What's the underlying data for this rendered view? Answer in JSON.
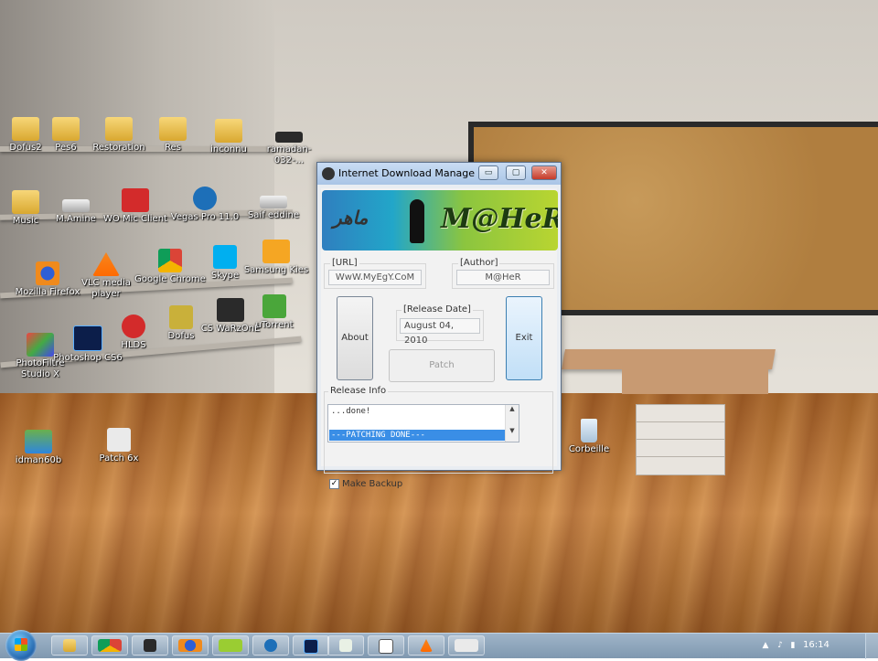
{
  "desktop": {
    "icons": [
      {
        "label": "Dofus2",
        "icon": "folder-icon"
      },
      {
        "label": "Pes6",
        "icon": "folder-icon"
      },
      {
        "label": "Restoration",
        "icon": "folder-icon"
      },
      {
        "label": "Res",
        "icon": "folder-icon"
      },
      {
        "label": "inconnu",
        "icon": "folder-icon"
      },
      {
        "label": "ramadan-032-...",
        "icon": "file-icon"
      },
      {
        "label": "Music",
        "icon": "folder-icon"
      },
      {
        "label": "M.Amine",
        "icon": "drive-icon"
      },
      {
        "label": "WO Mic Client",
        "icon": "mic-icon"
      },
      {
        "label": "Vegas Pro 11.0",
        "icon": "vegas-icon"
      },
      {
        "label": "Saif eddine",
        "icon": "drive-icon"
      },
      {
        "label": "Mozilla Firefox",
        "icon": "firefox-icon"
      },
      {
        "label": "VLC media player",
        "icon": "vlc-icon"
      },
      {
        "label": "Google Chrome",
        "icon": "chrome-icon"
      },
      {
        "label": "Skype",
        "icon": "skype-icon"
      },
      {
        "label": "Samsung Kies",
        "icon": "kies-icon"
      },
      {
        "label": "Photoshop CS6",
        "icon": "photoshop-icon"
      },
      {
        "label": "HLDS",
        "icon": "hlds-icon"
      },
      {
        "label": "Dofus",
        "icon": "dofus-icon"
      },
      {
        "label": "CS WaRzOnE",
        "icon": "cs-icon"
      },
      {
        "label": "uTorrent",
        "icon": "utorrent-icon"
      },
      {
        "label": "PhotoFiltre Studio X",
        "icon": "photofiltre-icon"
      },
      {
        "label": "idman60b",
        "icon": "idm-icon"
      },
      {
        "label": "Patch 6x",
        "icon": "alien-icon"
      },
      {
        "label": "Corbeille",
        "icon": "recycle-bin-icon"
      }
    ]
  },
  "window": {
    "title": "Internet Download Manager...",
    "minimize": "▭",
    "maximize": "▢",
    "close": "✕",
    "banner_arabic": "ماهر",
    "banner_logo": "M@HeR",
    "url_label": "[URL]",
    "url_value": "WwW.MyEgY.CoM",
    "author_label": "[Author]",
    "author_value": "M@HeR",
    "release_label": "[Release Date]",
    "release_value": "August 04, 2010",
    "about_button": "About",
    "exit_button": "Exit",
    "patch_button": "Patch",
    "release_info_label": "Release Info",
    "info_lines": [
      "...done!"
    ],
    "info_selected": "---PATCHING DONE---",
    "make_backup_label": "Make Backup",
    "make_backup_checked": "✓"
  },
  "taskbar": {
    "items": [
      "explorer",
      "chrome",
      "media",
      "firefox",
      "vlc",
      "vegas",
      "photoshop",
      "notepad",
      "window",
      "vlc-2",
      "alien"
    ],
    "clock": "16:14"
  }
}
